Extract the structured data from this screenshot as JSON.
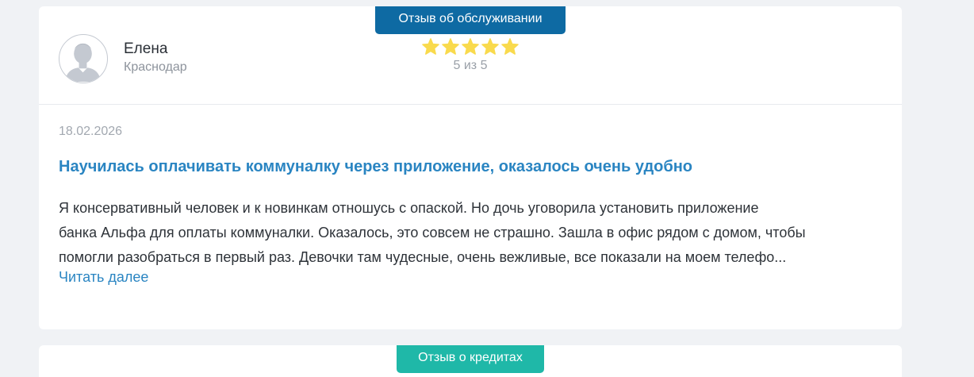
{
  "review": {
    "badge": "Отзыв об обслуживании",
    "author": {
      "name": "Елена",
      "city": "Краснодар"
    },
    "rating": {
      "value": 5,
      "max": 5,
      "text": "5 из 5",
      "star_color": "#f9da4d"
    },
    "date": "18.02.2026",
    "title": "Научилась оплачивать коммуналку через приложение, оказалось очень удобно",
    "body_lines": [
      "Я консервативный человек и к новинкам отношусь с опаской. Но дочь уговорила установить приложение",
      "банка Альфа для оплаты коммуналки. Оказалось, это совсем не страшно. Зашла в офис рядом с домом, чтобы",
      "помогли разобраться в первый раз. Девочки там чудесные, очень вежливые, все показали на моем телефо..."
    ],
    "read_more": "Читать далее",
    "badge_color": "#0e6aa3",
    "link_color": "#2a85c2"
  },
  "next_review": {
    "badge": "Отзыв о кредитах",
    "badge_color": "#1fb8a8"
  }
}
